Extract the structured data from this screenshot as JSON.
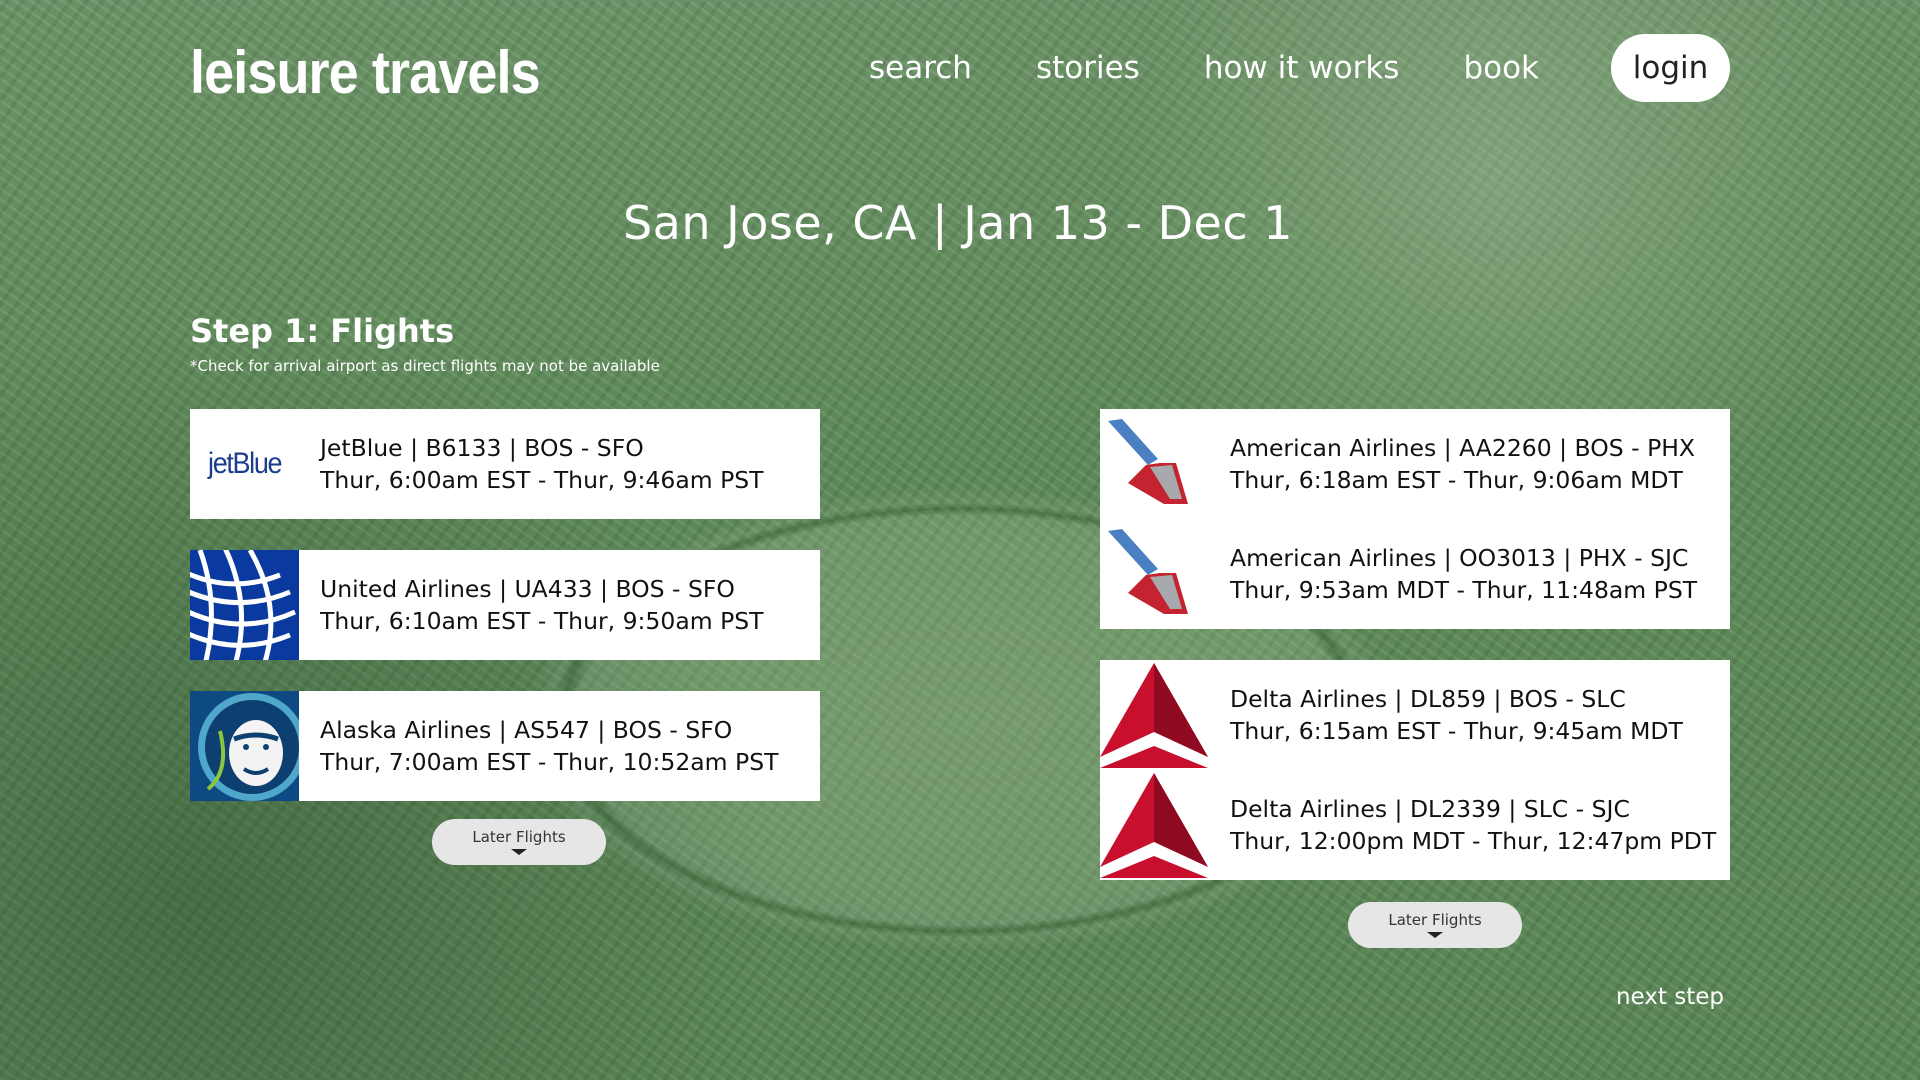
{
  "brand": {
    "name": "leisure travels"
  },
  "nav": {
    "search": "search",
    "stories": "stories",
    "how_it_works": "how it works",
    "book": "book",
    "login": "login"
  },
  "trip": {
    "title": "San Jose, CA | Jan 13 - Dec 1"
  },
  "step": {
    "title": "Step 1: Flights",
    "note": "*Check for arrival airport as direct flights may not be available"
  },
  "flights_left": [
    {
      "airline_logo": "jetblue-logo",
      "logo_text": "jetBlue",
      "line1": "JetBlue | B6133 | BOS - SFO",
      "line2": "Thur, 6:00am EST - Thur, 9:46am PST"
    },
    {
      "airline_logo": "united-globe-logo",
      "line1": "United Airlines | UA433 | BOS - SFO",
      "line2": "Thur, 6:10am EST - Thur, 9:50am PST"
    },
    {
      "airline_logo": "alaska-eskimo-logo",
      "line1": "Alaska Airlines | AS547 | BOS - SFO",
      "line2": "Thur, 7:00am EST - Thur, 10:52am PST"
    }
  ],
  "flights_right": [
    {
      "legs": [
        {
          "airline_logo": "american-airlines-logo",
          "line1": "American Airlines | AA2260 | BOS - PHX",
          "line2": "Thur, 6:18am EST - Thur, 9:06am MDT"
        },
        {
          "airline_logo": "american-airlines-logo",
          "line1": "American Airlines | OO3013 |  PHX - SJC",
          "line2": "Thur, 9:53am MDT - Thur, 11:48am PST"
        }
      ]
    },
    {
      "legs": [
        {
          "airline_logo": "delta-widget-logo",
          "line1": "Delta Airlines | DL859 | BOS - SLC",
          "line2": "Thur, 6:15am EST - Thur, 9:45am MDT"
        },
        {
          "airline_logo": "delta-widget-logo",
          "line1": "Delta Airlines | DL2339 |  SLC - SJC",
          "line2": "Thur, 12:00pm MDT - Thur, 12:47pm PDT"
        }
      ]
    }
  ],
  "later_flights_label": "Later Flights",
  "next_step_label": "next step",
  "colors": {
    "overlay_green": "#5f8c5c",
    "jetblue": "#1a3d8f",
    "united": "#0a3aa0",
    "alaska": "#0d4a84",
    "american_red": "#c4242f",
    "american_blue": "#4a7fc1",
    "delta_red": "#c8102e"
  }
}
